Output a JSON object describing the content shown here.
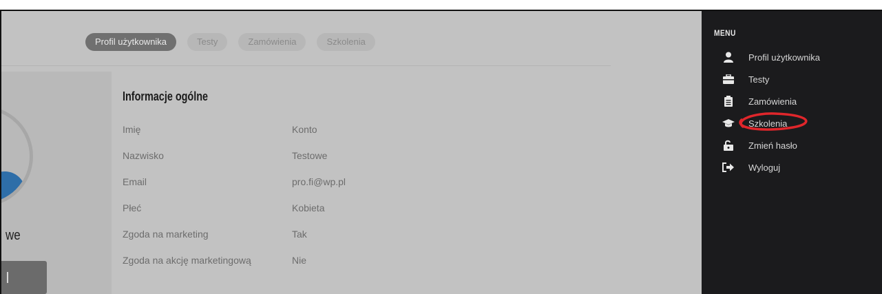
{
  "tabs": [
    {
      "label": "Profil użytkownika",
      "active": true
    },
    {
      "label": "Testy",
      "active": false
    },
    {
      "label": "Zamówienia",
      "active": false
    },
    {
      "label": "Szkolenia",
      "active": false
    }
  ],
  "profile": {
    "name_fragment": "we"
  },
  "info": {
    "title": "Informacje ogólne",
    "rows": [
      {
        "label": "Imię",
        "value": "Konto"
      },
      {
        "label": "Nazwisko",
        "value": "Testowe"
      },
      {
        "label": "Email",
        "value": "pro.fi@wp.pl"
      },
      {
        "label": "Płeć",
        "value": "Kobieta"
      },
      {
        "label": "Zgoda na marketing",
        "value": "Tak"
      },
      {
        "label": "Zgoda na akcję marketingową",
        "value": "Nie"
      }
    ]
  },
  "menu": {
    "heading": "MENU",
    "items": [
      {
        "label": "Profil użytkownika",
        "icon": "user-icon"
      },
      {
        "label": "Testy",
        "icon": "briefcase-icon"
      },
      {
        "label": "Zamówienia",
        "icon": "clipboard-icon"
      },
      {
        "label": "Szkolenia",
        "icon": "graduation-cap-icon",
        "highlighted": true
      },
      {
        "label": "Zmień hasło",
        "icon": "unlock-icon"
      },
      {
        "label": "Wyloguj",
        "icon": "sign-out-icon"
      }
    ]
  },
  "colors": {
    "sidebar_bg": "#1b1b1d",
    "content_bg": "#c2c2c2",
    "active_tab": "#707070",
    "highlight": "#e0262b"
  }
}
